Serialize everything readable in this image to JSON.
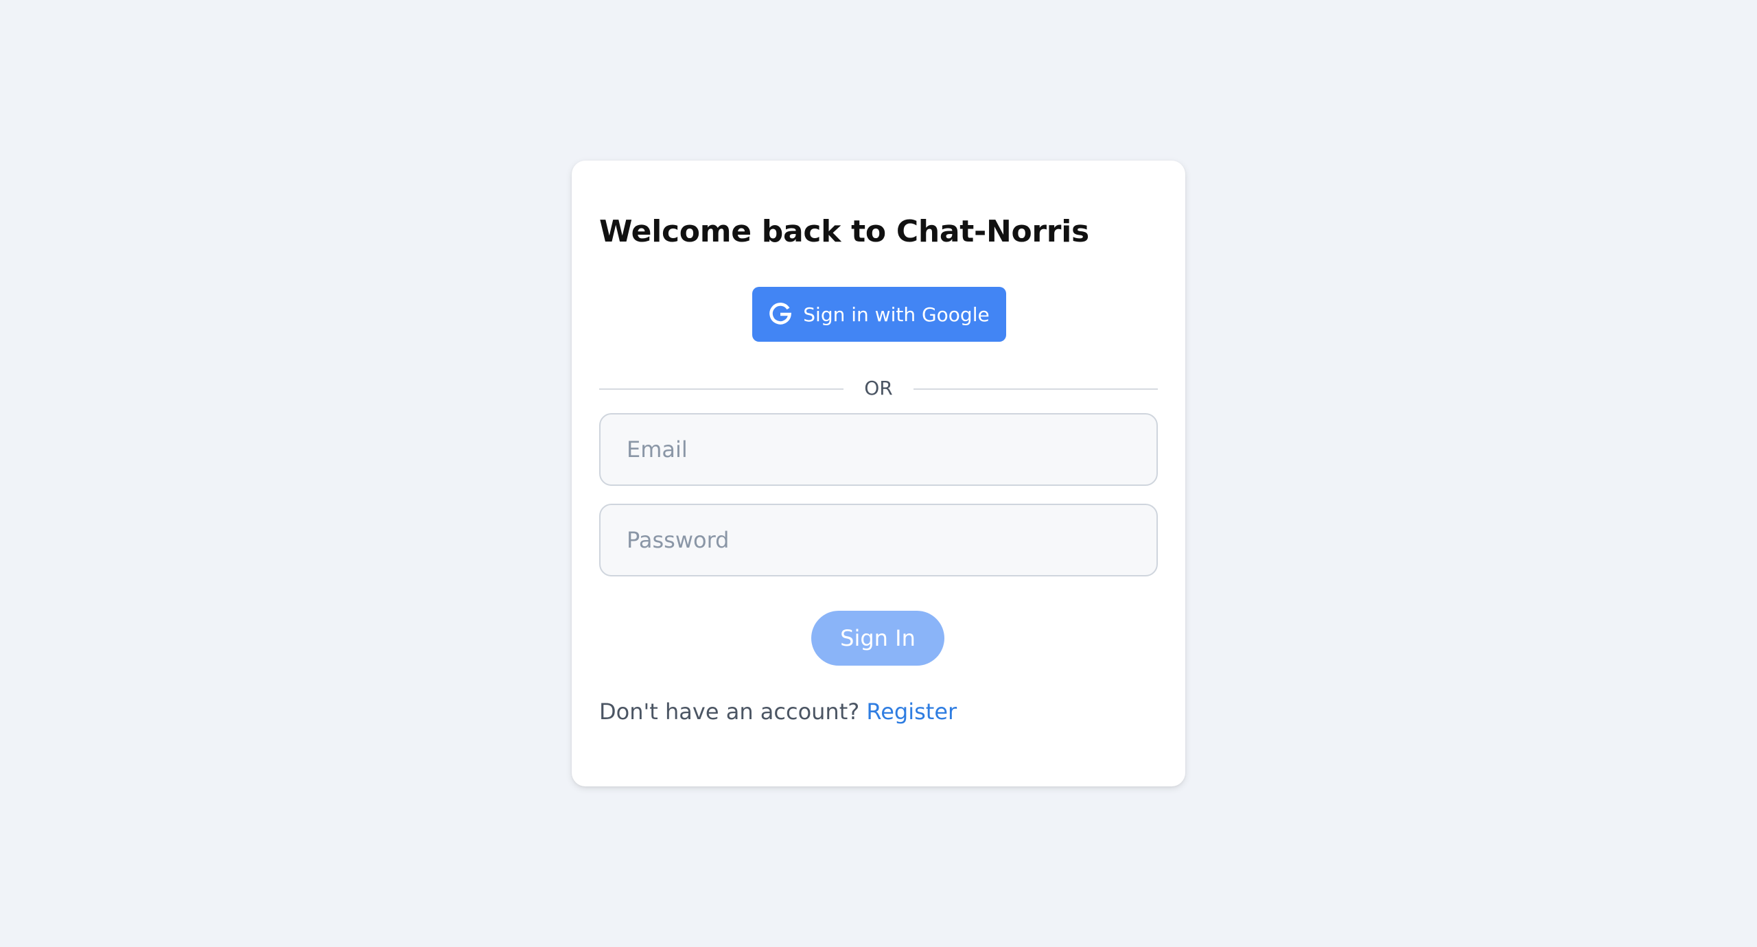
{
  "login": {
    "title": "Welcome back to Chat-Norris",
    "google_button_label": "Sign in with Google",
    "google_icon": "google-g-icon",
    "divider_text": "OR",
    "email_placeholder": "Email",
    "password_placeholder": "Password",
    "email_value": "",
    "password_value": "",
    "signin_button_label": "Sign In",
    "no_account_text": "Don't have an account?",
    "register_link_label": "Register"
  },
  "colors": {
    "page_background": "#f0f3f8",
    "card_background": "#ffffff",
    "google_button": "#4285f4",
    "signin_button_disabled": "#8ab4f8",
    "link": "#2f7de1"
  }
}
